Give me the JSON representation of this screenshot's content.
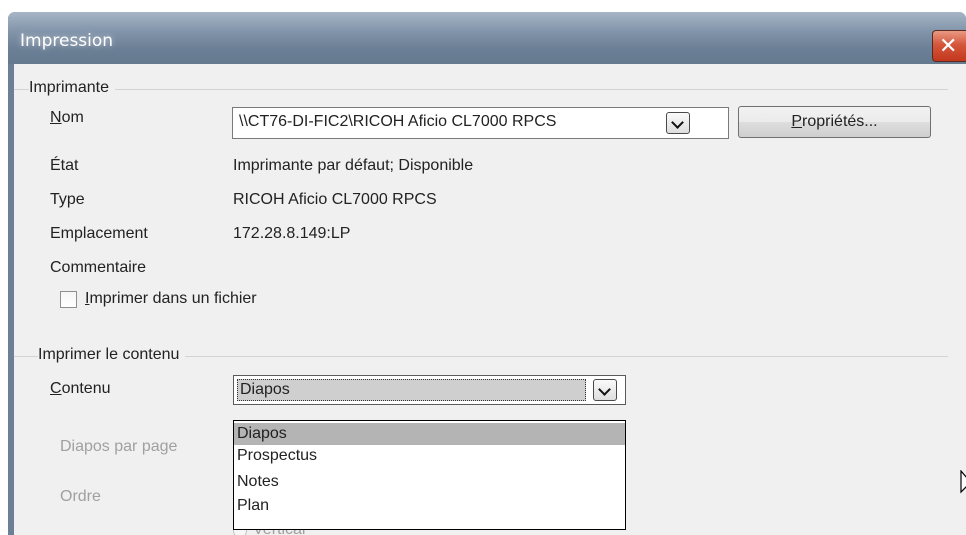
{
  "window": {
    "title": "Impression",
    "close_glyph": "✕"
  },
  "printer_section": {
    "label": "Imprimante",
    "name_label_underlined": "N",
    "name_label_rest": "om",
    "name_value": "\\\\CT76-DI-FIC2\\RICOH Aficio CL7000 RPCS",
    "properties_button_underlined": "P",
    "properties_button_rest": "ropriétés...",
    "status_label": "État",
    "status_value": "Imprimante par défaut; Disponible",
    "type_label": "Type",
    "type_value": "RICOH Aficio CL7000 RPCS",
    "location_label": "Emplacement",
    "location_value": "172.28.8.149:LP",
    "comment_label": "Commentaire",
    "print_to_file_underlined": "I",
    "print_to_file_rest": "mprimer dans un fichier",
    "print_to_file_checked": false
  },
  "content_section": {
    "label": "Imprimer le contenu",
    "content_label_underlined": "C",
    "content_label_rest": "ontenu",
    "content_value": "Diapos",
    "slides_per_page_label_pre": "Diapos par pa",
    "slides_per_page_label_underlined": "g",
    "slides_per_page_label_post": "e",
    "order_label": "Ordre",
    "vertical_option": "Vertical",
    "dropdown_options": [
      "Diapos",
      "Prospectus",
      "Notes",
      "Plan"
    ],
    "dropdown_selected": "Diapos"
  },
  "icons": {
    "close": "close-icon",
    "dropdown_arrow": "chevron-down-icon",
    "cursor": "mouse-pointer-icon"
  },
  "colors": {
    "titlebar": "#6c7f97",
    "close_button": "#d5573c",
    "dialog_background": "#f0f0f0",
    "selection": "#b4b4b4"
  }
}
